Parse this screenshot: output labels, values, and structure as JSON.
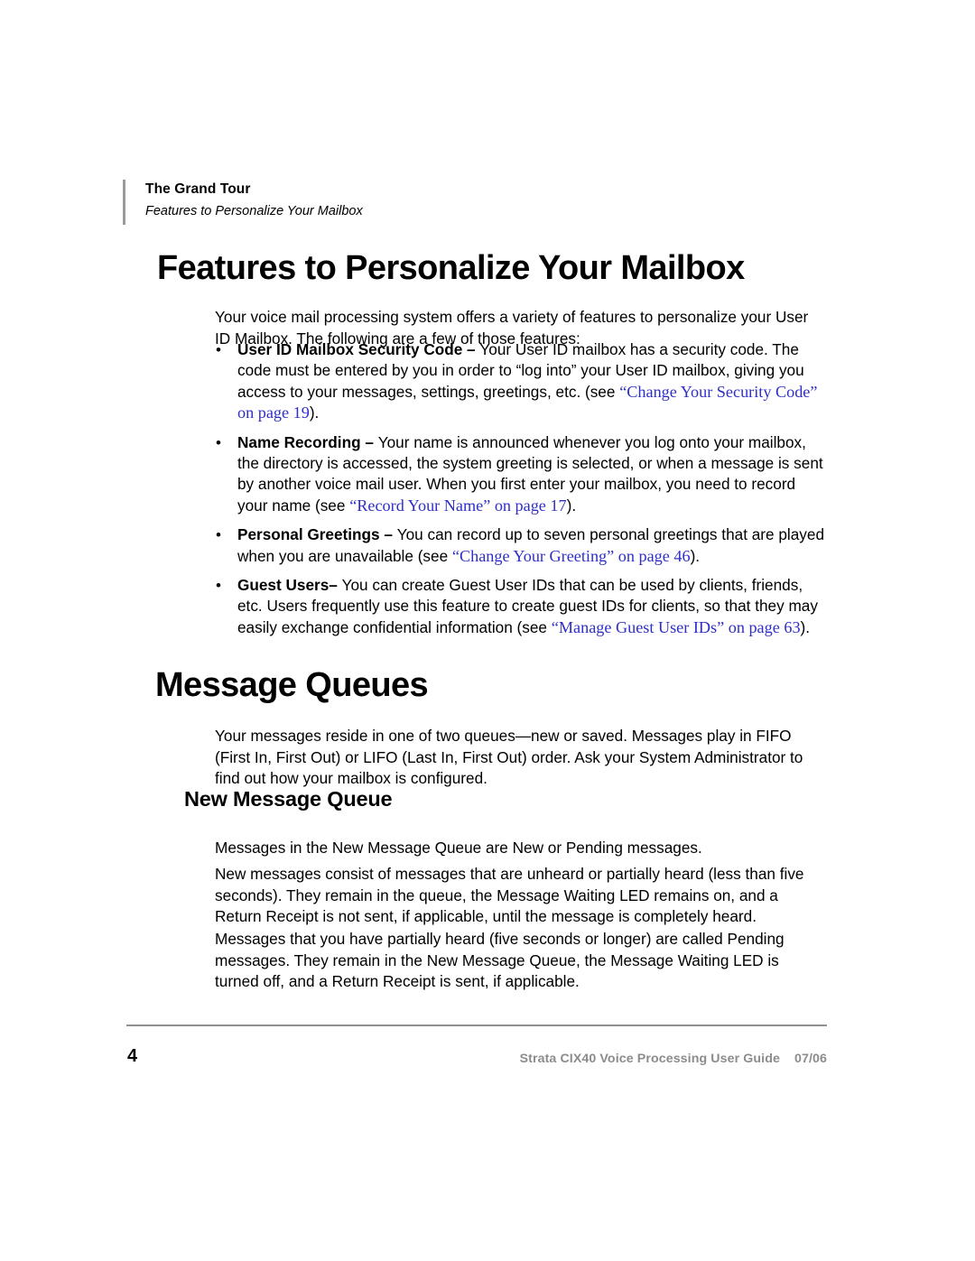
{
  "document": {
    "page_number": "4",
    "footer_title": "Strata CIX40 Voice Processing User Guide",
    "footer_date": "07/06"
  },
  "running_header": {
    "chapter": "The Grand Tour",
    "section": "Features to Personalize Your Mailbox"
  },
  "colors": {
    "xref_blue": "#2f2fc8",
    "rule_gray": "#8f8f8f",
    "footer_gray": "#8c8c8c",
    "header_bar_gray": "#9a9a9a",
    "text_black": "#000000",
    "page_background": "#ffffff"
  },
  "sections": {
    "features": {
      "heading": "Features to Personalize Your Mailbox",
      "intro": "Your voice mail processing system offers a variety of features to personalize your User ID Mailbox. The following are a few of those features:",
      "bullet_glyph": "•",
      "bullets": [
        {
          "term": "User ID Mailbox Security Code – ",
          "text_before": "Your User ID mailbox has a security code. The code must be entered by you in order to “log into” your User ID mailbox, giving you access to your messages, settings, greetings, etc. (see ",
          "xref": "“Change Your Security Code” on page 19",
          "text_after": ")."
        },
        {
          "term": "Name Recording – ",
          "text_before": "Your name is announced whenever you log onto your mailbox, the directory is accessed, the system greeting is selected, or when a message is sent by another voice mail user. When you first enter your mailbox, you need to record your name (see ",
          "xref": "“Record Your Name” on page 17",
          "text_after": ")."
        },
        {
          "term": "Personal Greetings – ",
          "text_before": "You can record up to seven personal greetings that are played when you are unavailable (see ",
          "xref": "“Change Your Greeting” on page 46",
          "text_after": ")."
        },
        {
          "term": "Guest Users– ",
          "text_before": "You can create Guest User IDs that can be used by clients, friends, etc. Users frequently use this feature to create guest IDs for clients, so that they may easily exchange confidential information (see ",
          "xref": "“Manage Guest User IDs” on page 63",
          "text_after": ")."
        }
      ]
    },
    "message_queues": {
      "heading": "Message Queues",
      "paragraph": "Your messages reside in one of two queues—new or saved. Messages play in FIFO (First In, First Out) or LIFO (Last In, First Out) order. Ask your System Administrator to find out how your mailbox is configured."
    },
    "new_message_queue": {
      "heading": "New Message Queue",
      "paragraph_1": "Messages in the New Message Queue are New or Pending messages.",
      "paragraph_2": "New messages consist of messages that are unheard or partially heard (less than five seconds). They remain in the queue, the Message Waiting LED remains on, and a Return Receipt is not sent, if applicable, until the message is completely heard.",
      "paragraph_3": "Messages that you have partially heard (five seconds or longer) are called Pending messages. They remain in the New Message Queue, the Message Waiting LED is turned off, and a Return Receipt is sent, if applicable."
    }
  }
}
